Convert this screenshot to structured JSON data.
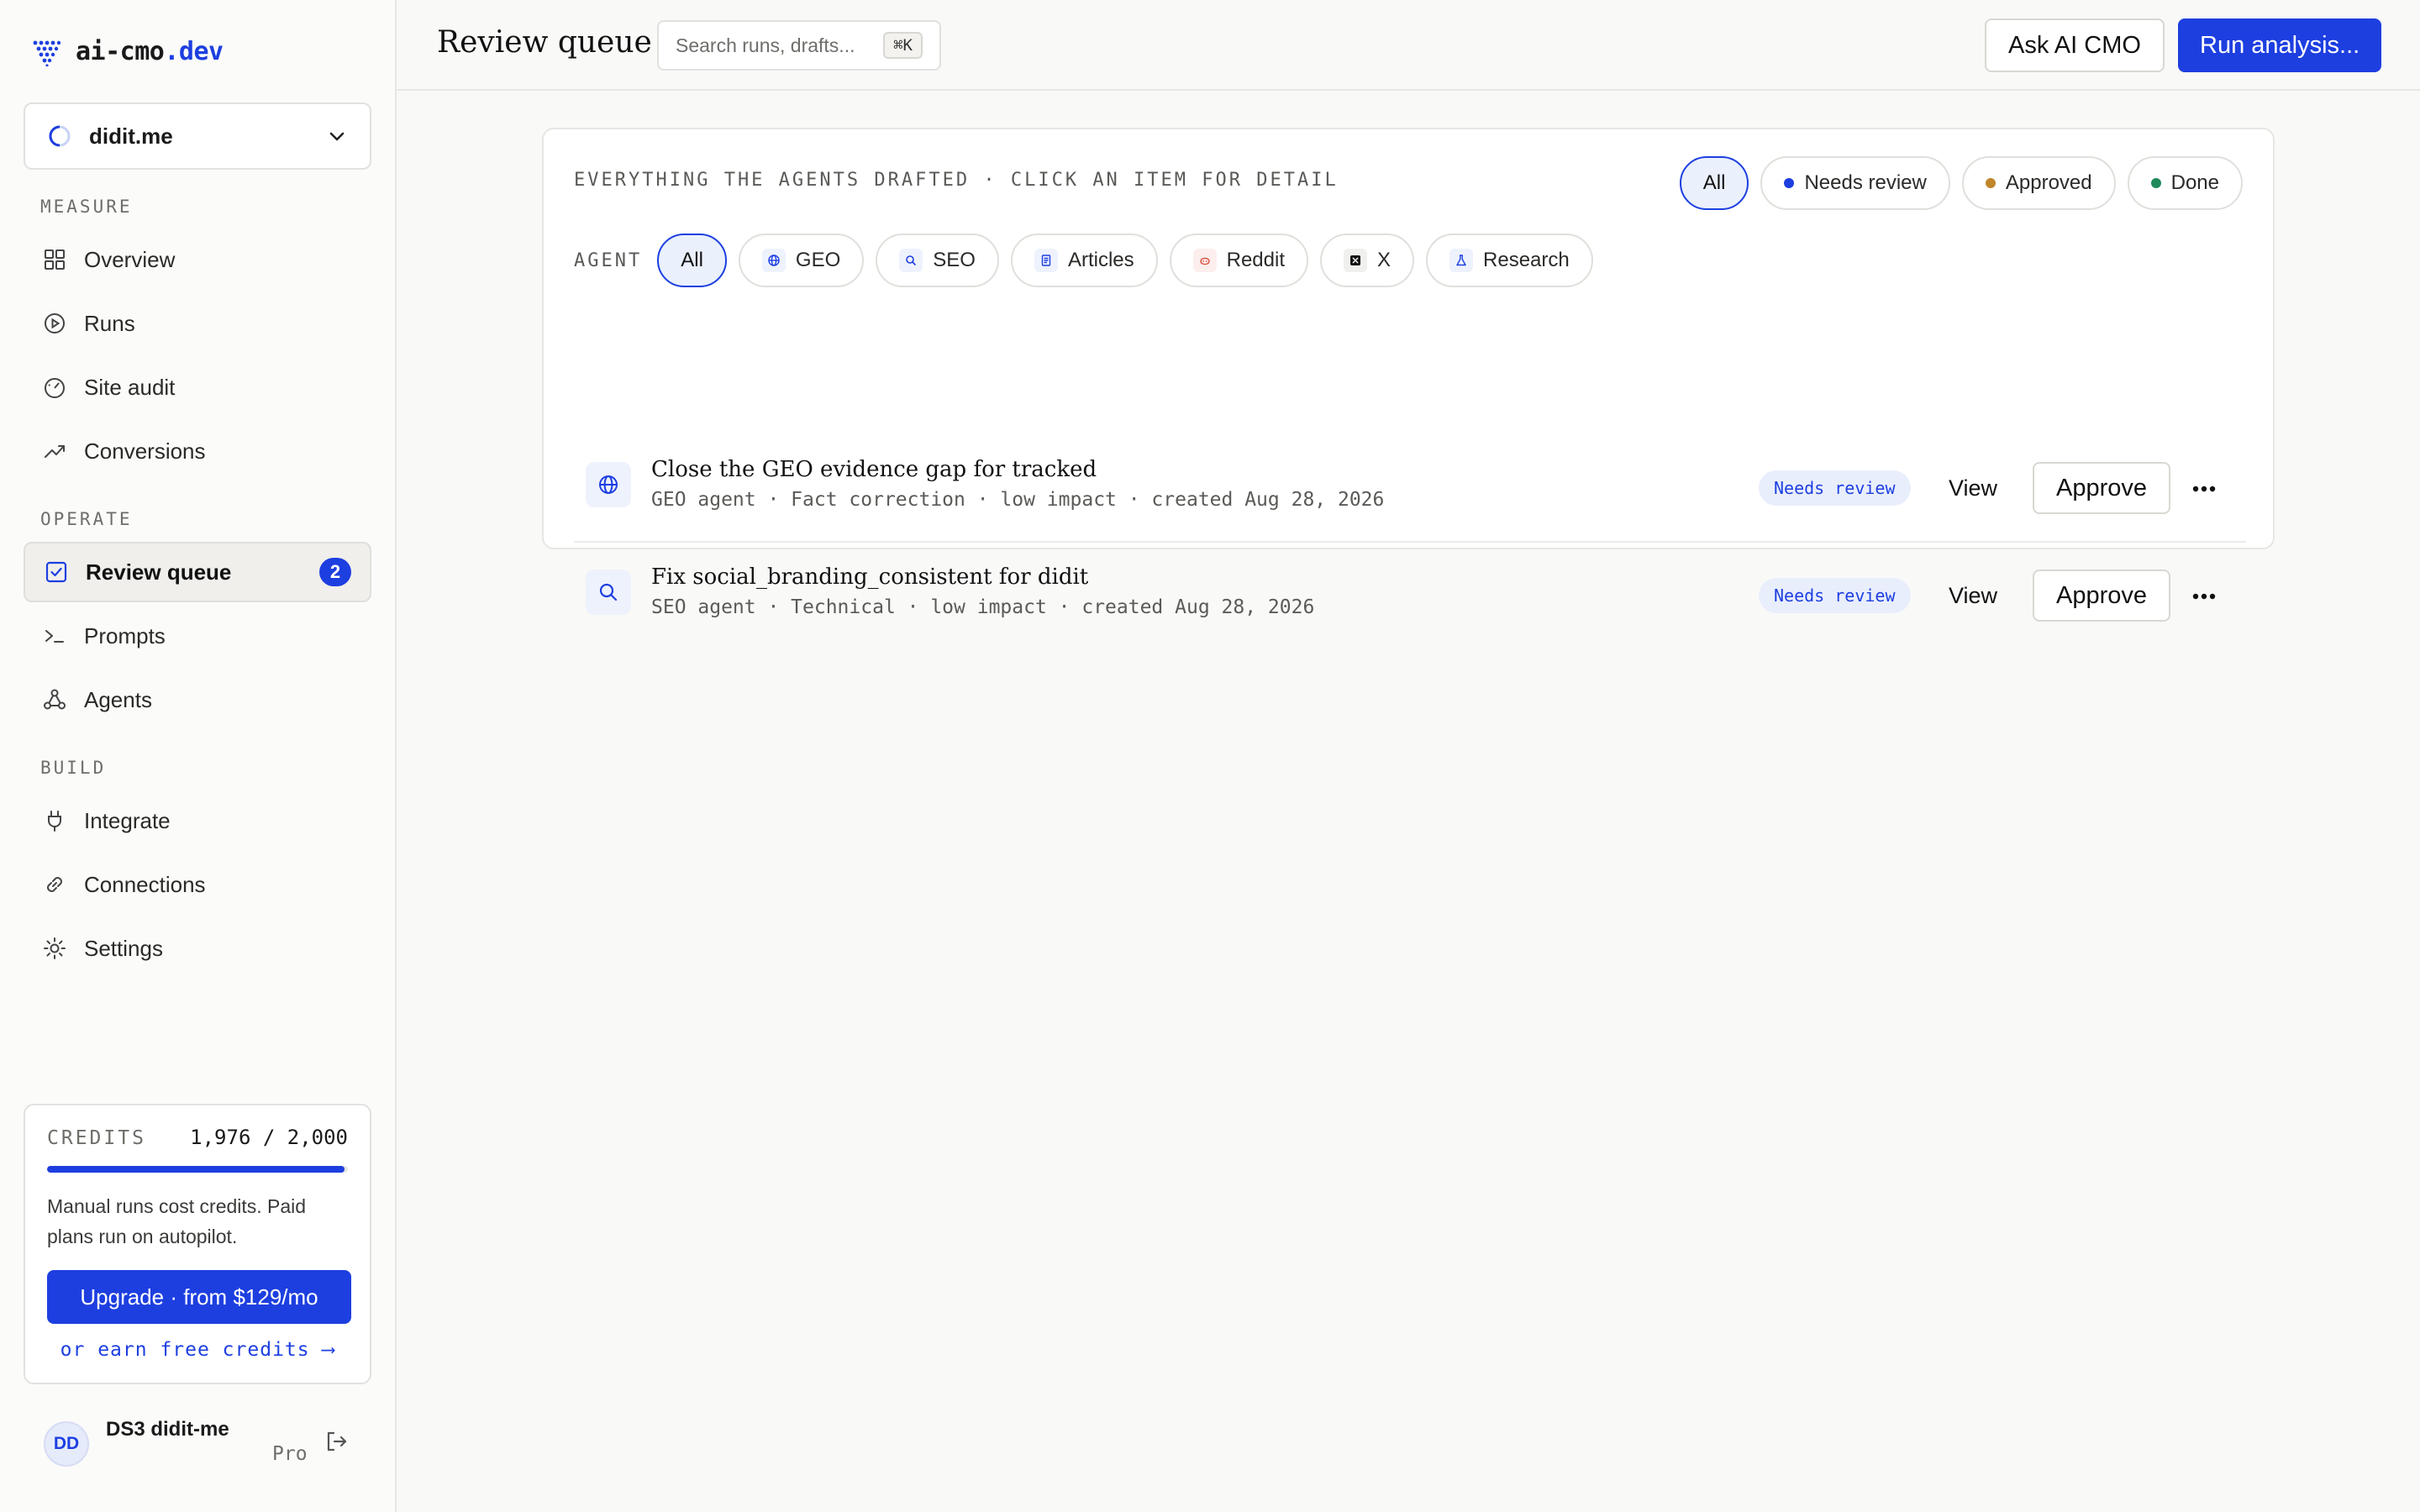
{
  "brand": {
    "name_prefix": "ai-cmo",
    "name_suffix": ".dev",
    "accent": "#1d3fe0"
  },
  "site_selector": {
    "value": "didit.me"
  },
  "sidebar": {
    "sections": [
      {
        "label": "MEASURE"
      },
      {
        "label": "OPERATE"
      },
      {
        "label": "BUILD"
      }
    ],
    "items": [
      {
        "label": "Overview",
        "icon": "grid-icon"
      },
      {
        "label": "Runs",
        "icon": "play-circle-icon"
      },
      {
        "label": "Site audit",
        "icon": "gauge-icon"
      },
      {
        "label": "Conversions",
        "icon": "trend-up-icon"
      },
      {
        "label": "Review queue",
        "icon": "checkbox-icon",
        "badge": "2",
        "active": true
      },
      {
        "label": "Prompts",
        "icon": "terminal-icon"
      },
      {
        "label": "Agents",
        "icon": "nodes-icon"
      },
      {
        "label": "Integrate",
        "icon": "plug-icon"
      },
      {
        "label": "Connections",
        "icon": "link-icon"
      },
      {
        "label": "Settings",
        "icon": "gear-icon"
      }
    ]
  },
  "credits": {
    "label": "CREDITS",
    "value_text": "1,976 / 2,000",
    "used": 1976,
    "total": 2000,
    "note": "Manual runs cost credits. Paid plans run on autopilot.",
    "upgrade_label": "Upgrade · from $129/mo",
    "earn_label": "or earn free credits ⟶"
  },
  "user": {
    "initials": "DD",
    "name": "DS3 didit-me",
    "plan": "Pro"
  },
  "topbar": {
    "title": "Review queue",
    "search_placeholder": "Search runs, drafts...",
    "search_shortcut": "⌘K",
    "ask_label": "Ask AI CMO",
    "run_label": "Run analysis..."
  },
  "queue": {
    "caption": "EVERYTHING THE AGENTS DRAFTED · CLICK AN ITEM FOR DETAIL",
    "status_filters": [
      {
        "label": "All",
        "selected": true
      },
      {
        "label": "Needs review",
        "dot_color": "#1d3fe0"
      },
      {
        "label": "Approved",
        "dot_color": "#c0862a"
      },
      {
        "label": "Done",
        "dot_color": "#1f8a5b"
      }
    ],
    "agent_label": "AGENT",
    "agent_filters": [
      {
        "label": "All",
        "selected": true
      },
      {
        "label": "GEO",
        "icon": "globe-icon"
      },
      {
        "label": "SEO",
        "icon": "search-icon"
      },
      {
        "label": "Articles",
        "icon": "document-icon"
      },
      {
        "label": "Reddit",
        "icon": "reddit-icon"
      },
      {
        "label": "X",
        "icon": "x-icon"
      },
      {
        "label": "Research",
        "icon": "flask-icon"
      }
    ],
    "items": [
      {
        "title": "Close the GEO evidence gap for tracked",
        "meta": "GEO agent · Fact correction · low impact · created Aug 28, 2026",
        "status": "Needs review",
        "icon": "globe-icon",
        "view_label": "View",
        "approve_label": "Approve"
      },
      {
        "title": "Fix social_branding_consistent for didit",
        "meta": "SEO agent · Technical · low impact · created Aug 28, 2026",
        "status": "Needs review",
        "icon": "search-icon",
        "view_label": "View",
        "approve_label": "Approve"
      }
    ]
  }
}
